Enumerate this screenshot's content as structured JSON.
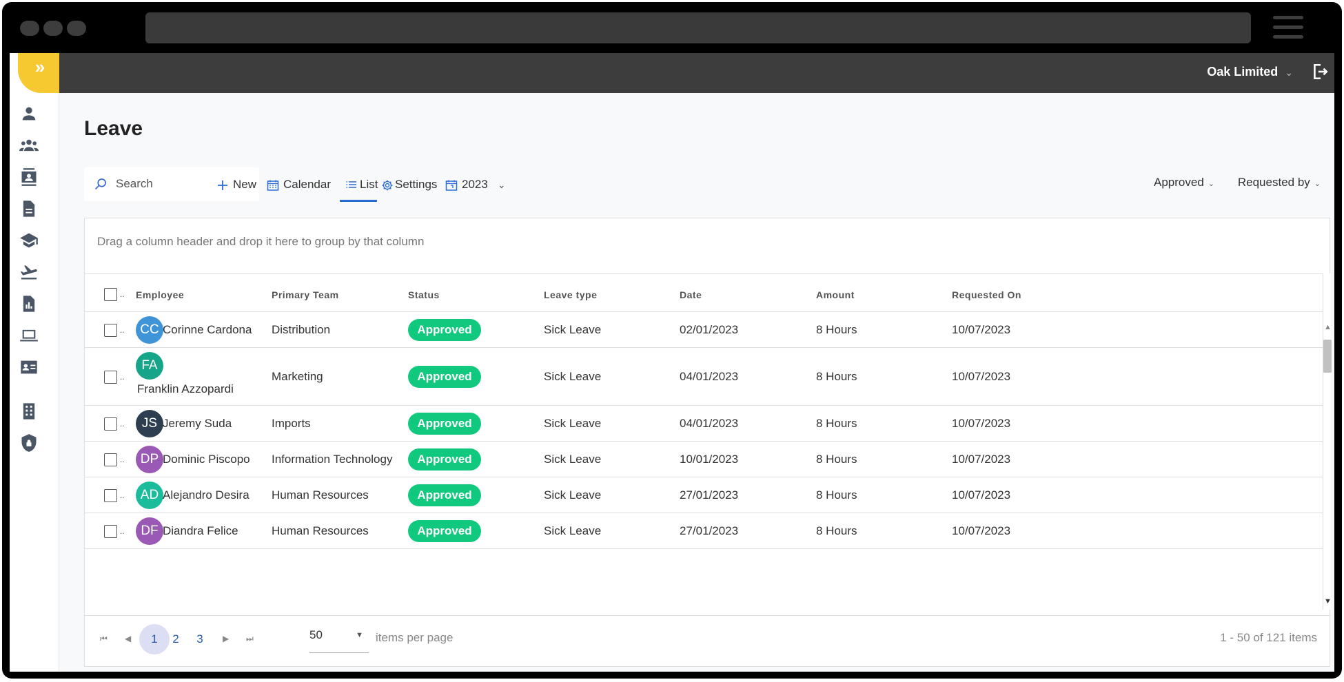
{
  "header": {
    "company": "Oak Limited"
  },
  "page": {
    "title": "Leave"
  },
  "toolbar": {
    "search_placeholder": "Search",
    "new": "New",
    "calendar": "Calendar",
    "list": "List",
    "settings": "Settings",
    "year": "2023",
    "filter_status": "Approved",
    "filter_requested_by": "Requested by"
  },
  "grid": {
    "group_hint": "Drag a column header and drop it here to group by that column",
    "columns": [
      "Employee",
      "Primary Team",
      "Status",
      "Leave type",
      "Date",
      "Amount",
      "Requested On"
    ],
    "rows": [
      {
        "initials": "CC",
        "employee": "Corinne Cardona",
        "color": "#3f94d8",
        "team": "Distribution",
        "status": "Approved",
        "leave_type": "Sick Leave",
        "date": "02/01/2023",
        "amount": "8 Hours",
        "requested_on": "10/07/2023"
      },
      {
        "initials": "FA",
        "employee": "Franklin Azzopardi",
        "color": "#17a589",
        "team": "Marketing",
        "status": "Approved",
        "leave_type": "Sick Leave",
        "date": "04/01/2023",
        "amount": "8 Hours",
        "requested_on": "10/07/2023"
      },
      {
        "initials": "JS",
        "employee": "Jeremy Suda",
        "color": "#2c3e50",
        "team": "Imports",
        "status": "Approved",
        "leave_type": "Sick Leave",
        "date": "04/01/2023",
        "amount": "8 Hours",
        "requested_on": "10/07/2023"
      },
      {
        "initials": "DP",
        "employee": "Dominic Piscopo",
        "color": "#9b59b6",
        "team": "Information Technology",
        "status": "Approved",
        "leave_type": "Sick Leave",
        "date": "10/01/2023",
        "amount": "8 Hours",
        "requested_on": "10/07/2023"
      },
      {
        "initials": "AD",
        "employee": "Alejandro Desira",
        "color": "#1abc9c",
        "team": "Human Resources",
        "status": "Approved",
        "leave_type": "Sick Leave",
        "date": "27/01/2023",
        "amount": "8 Hours",
        "requested_on": "10/07/2023"
      },
      {
        "initials": "DF",
        "employee": "Diandra Felice",
        "color": "#9b59b6",
        "team": "Human Resources",
        "status": "Approved",
        "leave_type": "Sick Leave",
        "date": "27/01/2023",
        "amount": "8 Hours",
        "requested_on": "10/07/2023"
      }
    ]
  },
  "pager": {
    "pages": [
      "1",
      "2",
      "3"
    ],
    "current_page": "1",
    "page_size": "50",
    "per_page_label": "items per page",
    "range": "1 - 50 of 121 items"
  },
  "colors": {
    "accent": "#f5c92f",
    "topbar": "#3d3d3d",
    "status_approved": "#10c97f",
    "link": "#2a6cd6"
  },
  "sidebar_icons": [
    "person-icon",
    "team-icon",
    "directory-icon",
    "document-icon",
    "training-icon",
    "travel-icon",
    "report-icon",
    "laptop-icon",
    "id-card-icon",
    "building-icon",
    "security-icon"
  ]
}
